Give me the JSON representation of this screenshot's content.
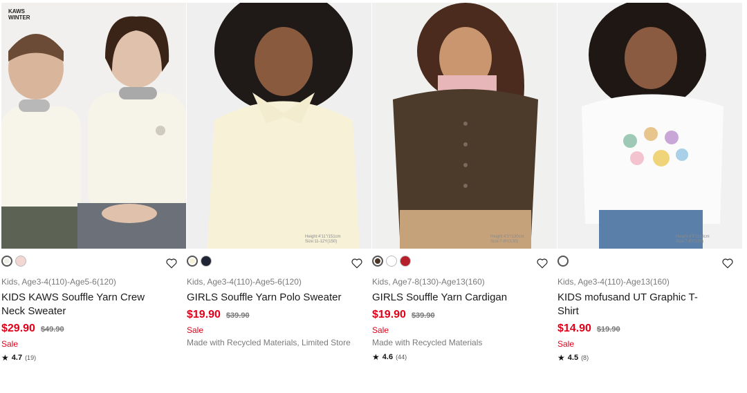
{
  "products": [
    {
      "badge": "KAWS\nWINTER",
      "mini_label": "",
      "swatches": [
        {
          "color": "#f0efe8",
          "selected": true
        },
        {
          "color": "#f2d7d2",
          "selected": false
        }
      ],
      "category": "Kids, Age3-4(110)-Age5-6(120)",
      "name": "KIDS KAWS Souffle Yarn Crew Neck Sweater",
      "price": "$29.90",
      "original_price": "$49.90",
      "sale": "Sale",
      "note": "",
      "rating": "4.7",
      "rating_count": "(19)"
    },
    {
      "badge": "",
      "mini_label": "Height:4'11\"/151cm\nSize:11-12Y(150)",
      "swatches": [
        {
          "color": "#f6f0d8",
          "selected": true
        },
        {
          "color": "#1f2535",
          "selected": false
        }
      ],
      "category": "Kids, Age3-4(110)-Age5-6(120)",
      "name": "GIRLS Souffle Yarn Polo Sweater",
      "price": "$19.90",
      "original_price": "$39.90",
      "sale": "Sale",
      "note": "Made with Recycled Materials, Limited Store",
      "rating": "",
      "rating_count": ""
    },
    {
      "badge": "",
      "mini_label": "Height:4'3\"/130cm\nSize:7-8Y(130)",
      "swatches": [
        {
          "color": "#4a3527",
          "selected": true
        },
        {
          "color": "#ffffff",
          "selected": false
        },
        {
          "color": "#b5202a",
          "selected": false
        }
      ],
      "category": "Kids, Age7-8(130)-Age13(160)",
      "name": "GIRLS Souffle Yarn Cardigan",
      "price": "$19.90",
      "original_price": "$39.90",
      "sale": "Sale",
      "note": "Made with Recycled Materials",
      "rating": "4.6",
      "rating_count": "(44)"
    },
    {
      "badge": "",
      "mini_label": "Height:4'5\"/133cm\nSize:7-8Y(130)",
      "swatches": [
        {
          "color": "#ffffff",
          "selected": true
        }
      ],
      "category": "Kids, Age3-4(110)-Age13(160)",
      "name": "KIDS mofusand UT Graphic T-Shirt",
      "price": "$14.90",
      "original_price": "$19.90",
      "sale": "Sale",
      "note": "",
      "rating": "4.5",
      "rating_count": "(8)"
    }
  ],
  "icons": {
    "heart": "heart-icon",
    "star": "star-icon"
  }
}
